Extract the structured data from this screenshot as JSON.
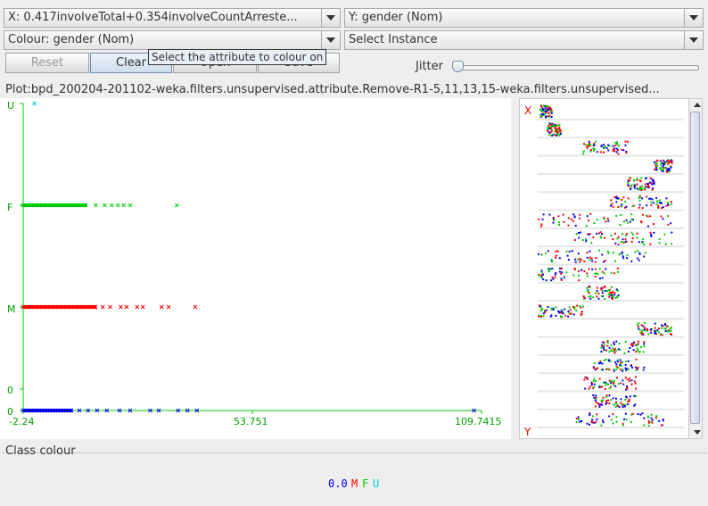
{
  "controls": {
    "x_axis": "X: 0.417involveTotal+0.354involveCountArreste...",
    "y_axis": "Y: gender (Nom)",
    "colour": "Colour: gender (Nom)",
    "instance": "Select Instance",
    "reset_label": "Reset",
    "clear_label": "Clear",
    "open_label": "Open",
    "save_label": "Save",
    "tooltip": "Select the attribute to colour on",
    "jitter_label": "Jitter"
  },
  "plot": {
    "title": "Plot:bpd_200204-201102-weka.filters.unsupervised.attribute.Remove-R1-5,11,13,15-weka.filters.unsupervised...",
    "y_ticks": [
      "U",
      "F",
      "M",
      "0",
      "0"
    ],
    "x_ticks": [
      "-2.24",
      "53.751",
      "109.7415"
    ],
    "x_min": -2.24,
    "x_max": 109.7415
  },
  "chart_data": {
    "type": "scatter",
    "y_categories": [
      "0",
      "0",
      "M",
      "F",
      "U"
    ],
    "x_range": [
      -2.24,
      109.7415
    ],
    "series": [
      {
        "name": "0.0",
        "color": "#0000ff",
        "y": "0",
        "x_dense_range": [
          -2.24,
          9.8
        ],
        "x_sparse": [
          11.5,
          13.6,
          15.8,
          18.2,
          21.3,
          23.9,
          28.8,
          30.9,
          35.6,
          37.9,
          40.2,
          107.9
        ]
      },
      {
        "name": "M",
        "color": "#ff0000",
        "y": "M",
        "x_dense_range": [
          -2.24,
          15.7
        ],
        "x_sparse": [
          17.2,
          19.0,
          21.6,
          23.0,
          25.6,
          27.0,
          31.6,
          33.3,
          39.8
        ]
      },
      {
        "name": "F",
        "color": "#00cc00",
        "y": "F",
        "x_dense_range": [
          -2.24,
          13.4
        ],
        "x_sparse": [
          15.5,
          17.7,
          19.4,
          20.9,
          22.3,
          23.9,
          35.3
        ]
      },
      {
        "name": "U",
        "color": "#00cccc",
        "y": "U",
        "x_sparse": [
          0.5
        ]
      }
    ]
  },
  "legend": [
    {
      "label": "0.0",
      "color": "#0000ff"
    },
    {
      "label": "M",
      "color": "#ff0000"
    },
    {
      "label": "F",
      "color": "#00cc00"
    },
    {
      "label": "U",
      "color": "#00cccc"
    }
  ],
  "side_panel": {
    "x_label": "X",
    "y_label": "Y"
  },
  "class_colour_title": "Class colour"
}
